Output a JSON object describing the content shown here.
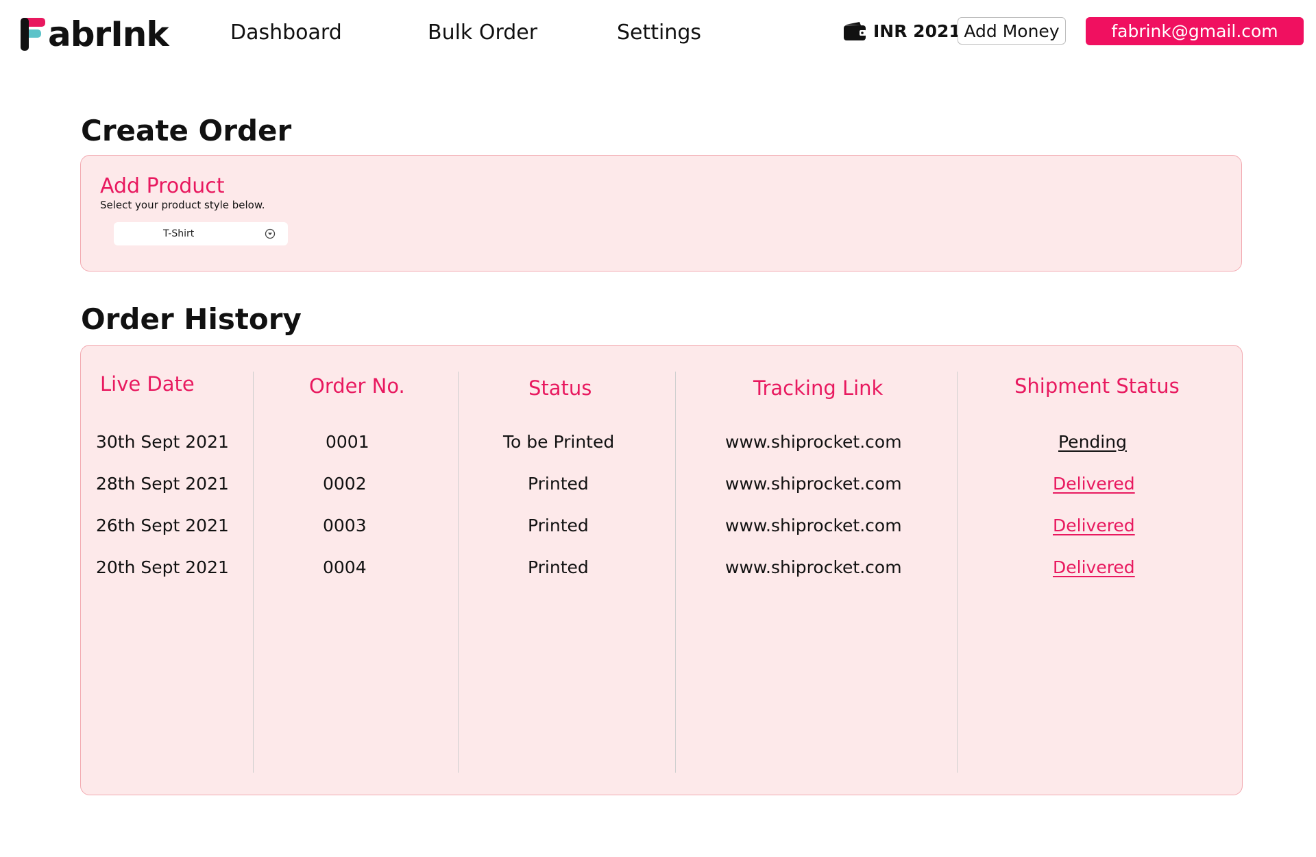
{
  "header": {
    "logo_text": "abrInk",
    "nav": [
      "Dashboard",
      "Bulk Order",
      "Settings"
    ],
    "wallet_icon": "wallet-icon",
    "balance": "INR 2021",
    "add_money_label": "Add Money",
    "account_email": "fabrink@gmail.com"
  },
  "create_order": {
    "title": "Create Order",
    "add_product_title": "Add Product",
    "add_product_subtitle": "Select your product style below.",
    "product_select": "T-Shirt",
    "select_icon": "chevron-down-circle-icon"
  },
  "order_history": {
    "title": "Order History",
    "columns": [
      "Live Date",
      "Order No.",
      "Status",
      "Tracking Link",
      "Shipment Status"
    ],
    "rows": [
      {
        "date": "30th Sept 2021",
        "order_no": "0001",
        "status": "To be Printed",
        "tracking": "www.shiprocket.com",
        "shipment": "Pending"
      },
      {
        "date": "28th Sept 2021",
        "order_no": "0002",
        "status": "Printed",
        "tracking": "www.shiprocket.com",
        "shipment": "Delivered"
      },
      {
        "date": "26th Sept 2021",
        "order_no": "0003",
        "status": "Printed",
        "tracking": "www.shiprocket.com",
        "shipment": "Delivered"
      },
      {
        "date": "20th Sept 2021",
        "order_no": "0004",
        "status": "Printed",
        "tracking": "www.shiprocket.com",
        "shipment": "Delivered"
      }
    ]
  },
  "colors": {
    "accent": "#e8195f",
    "button_pink": "#f01060",
    "panel_bg": "#fde9ea",
    "panel_border": "#f2a9b0"
  }
}
